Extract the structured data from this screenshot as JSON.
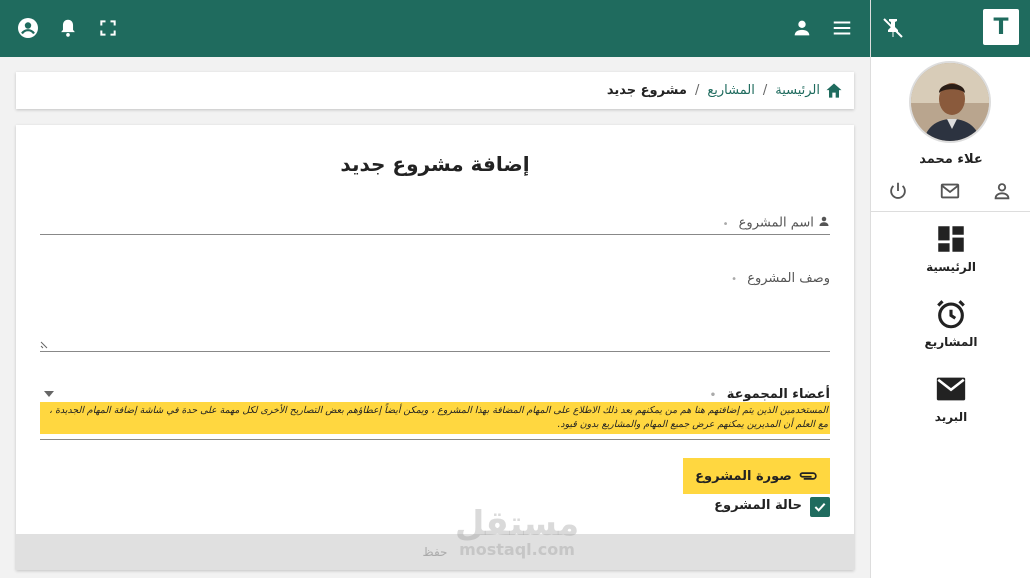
{
  "sidebar": {
    "logo_letter": "T",
    "user_name": "علاء محمد",
    "nav": [
      {
        "label": "الرئيسية",
        "icon": "dashboard-icon"
      },
      {
        "label": "المشاريع",
        "icon": "alarm-clock-icon"
      },
      {
        "label": "البريد",
        "icon": "mail-icon"
      }
    ]
  },
  "breadcrumb": {
    "home": "الرئيسية",
    "projects": "المشاريع",
    "current": "مشروع جديد",
    "separator": "/"
  },
  "form": {
    "title": "إضافة مشروع جديد",
    "project_name_label": "اسم المشروع",
    "project_desc_label": "وصف المشروع",
    "members_label": "أعضاء المجموعة",
    "members_note": "المستخدمين الذين يتم إضافتهم هنا هم من يمكنهم بعد ذلك الاطلاع على المهام المضافة بهذا المشروع ، ويمكن أيضاً إعطاؤهم بعض التصاريح الأخرى لكل مهمة على حدة في شاشة إضافة المهام الجديدة ، مع العلم أن المديرين يمكنهم عرض جميع المهام والمشاريع بدون قيود.",
    "required_marker": "•",
    "upload_label": "صورة المشروع",
    "status_label": "حالة المشروع",
    "status_checked": true,
    "save_label": "حفظ"
  },
  "watermark": {
    "arabic": "مستقل",
    "latin": "mostaql.com"
  },
  "colors": {
    "primary": "#1f6b5e",
    "accent": "#ffd740",
    "background": "#f2f2f2"
  }
}
